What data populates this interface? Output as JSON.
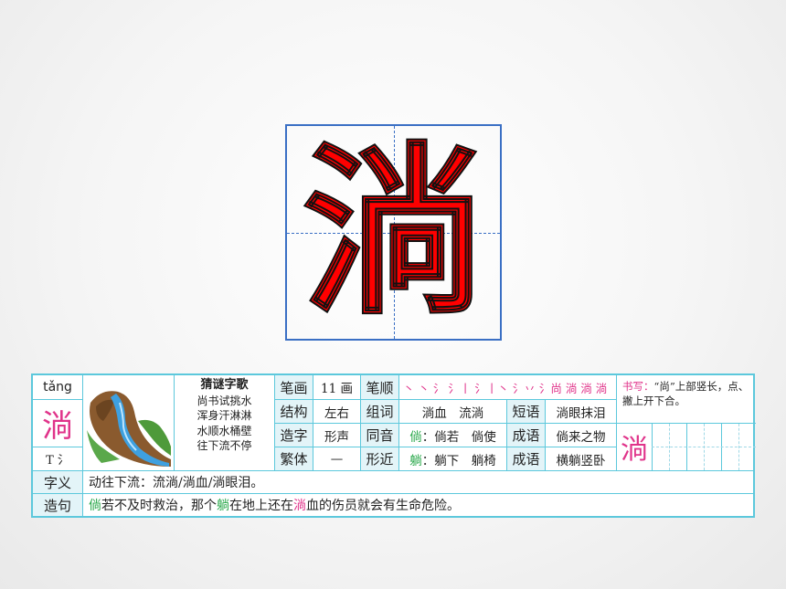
{
  "main_char": "淌",
  "card": {
    "pinyin": "tǎng",
    "char": "淌",
    "radical": "T 氵",
    "riddle_title": "猜谜字歌",
    "riddle_lines": [
      "尚书试挑水",
      "浑身汗淋淋",
      "水顺水桶壁",
      "往下流不停"
    ],
    "stroke_count_label": "笔画",
    "stroke_count_value": "11 画",
    "stroke_order_label": "笔顺",
    "stroke_order_value": "丶 丶 氵 氵丨 氵丨丶 氵丷 氵尚 淌 淌 淌",
    "structure_label": "结构",
    "structure_value": "左右",
    "words_label": "组词",
    "words_value": "淌血　流淌",
    "phrase_label": "短语",
    "phrase_value": "淌眼抹泪",
    "formation_label": "造字",
    "formation_value": "形声",
    "homophone_label": "同音",
    "homophone_char": "倘",
    "homophone_value": "：倘若　倘使",
    "idiom_label": "成语",
    "idiom1_value": "倘来之物",
    "traditional_label": "繁体",
    "traditional_value": "—",
    "similar_label": "形近",
    "similar_char": "躺",
    "similar_value": "：躺下　躺椅",
    "idiom2_value": "横躺竖卧",
    "writing_title": "书写：",
    "writing_tip": "“尚”上部竖长，点、撇上开下合。",
    "writing_char": "淌",
    "meaning_label": "字义",
    "meaning_value": "动往下流：流淌/淌血/淌眼泪。",
    "sentence_label": "造句",
    "sentence_part1": "倘",
    "sentence_part2": "若不及时救治，那个",
    "sentence_part3": "躺",
    "sentence_part4": "在地上还在",
    "sentence_part5": "淌",
    "sentence_part6": "血的伤员就会有生命危险。"
  }
}
